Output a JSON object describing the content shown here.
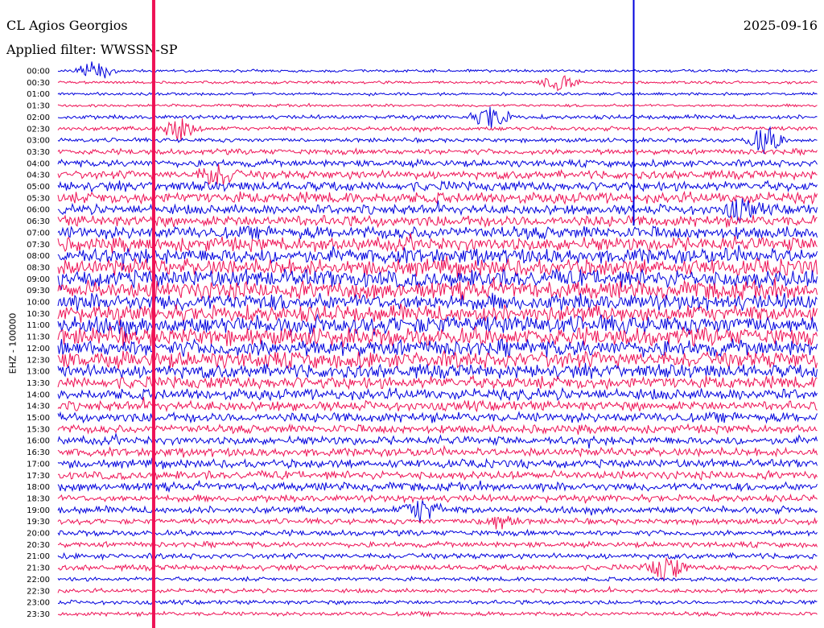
{
  "header": {
    "station": "CL Agios Georgios",
    "date": "2025-09-16",
    "filter": "Applied filter: WWSSN-SP"
  },
  "chart_data": {
    "type": "line",
    "ylabel": "EHZ - 100000",
    "row_labels": [
      "00:00",
      "00:30",
      "01:00",
      "01:30",
      "02:00",
      "02:30",
      "03:00",
      "03:30",
      "04:00",
      "04:30",
      "05:00",
      "05:30",
      "06:00",
      "06:30",
      "07:00",
      "07:30",
      "08:00",
      "08:30",
      "09:00",
      "09:30",
      "10:00",
      "10:30",
      "11:00",
      "11:30",
      "12:00",
      "12:30",
      "13:00",
      "13:30",
      "14:00",
      "14:30",
      "15:00",
      "15:30",
      "16:00",
      "16:30",
      "17:00",
      "17:30",
      "18:00",
      "18:30",
      "19:00",
      "19:30",
      "20:00",
      "20:30",
      "21:00",
      "21:30",
      "22:00",
      "22:30",
      "23:00",
      "23:30"
    ],
    "series_colors": [
      "#0000dd",
      "#ee1155"
    ],
    "noise_amplitude": [
      2,
      2,
      2,
      2,
      3,
      3,
      3,
      4,
      5,
      6,
      7,
      8,
      7,
      8,
      9,
      10,
      11,
      12,
      13,
      13,
      12,
      12,
      13,
      13,
      12,
      12,
      10,
      9,
      8,
      7,
      7,
      6,
      6,
      6,
      6,
      6,
      6,
      5,
      5,
      4,
      4,
      4,
      4,
      4,
      3,
      3,
      3,
      3
    ],
    "events": [
      {
        "row": 0,
        "time_frac": 0.05,
        "amplitude": 12
      },
      {
        "row": 1,
        "time_frac": 0.66,
        "amplitude": 10
      },
      {
        "row": 4,
        "time_frac": 0.57,
        "amplitude": 14
      },
      {
        "row": 5,
        "time_frac": 0.16,
        "amplitude": 14
      },
      {
        "row": 6,
        "time_frac": 0.93,
        "amplitude": 16
      },
      {
        "row": 9,
        "time_frac": 0.21,
        "amplitude": 14
      },
      {
        "row": 12,
        "time_frac": 0.9,
        "amplitude": 12
      },
      {
        "row": 38,
        "time_frac": 0.48,
        "amplitude": 14
      },
      {
        "row": 39,
        "time_frac": 0.58,
        "amplitude": 10
      },
      {
        "row": 43,
        "time_frac": 0.8,
        "amplitude": 16
      }
    ],
    "spikes": [
      {
        "time_frac": 0.126,
        "color": "#ee1155",
        "from_row": 0,
        "to_row": 47
      },
      {
        "time_frac": 0.759,
        "color": "#0000dd",
        "from_row": 0,
        "to_row": 12
      }
    ]
  }
}
